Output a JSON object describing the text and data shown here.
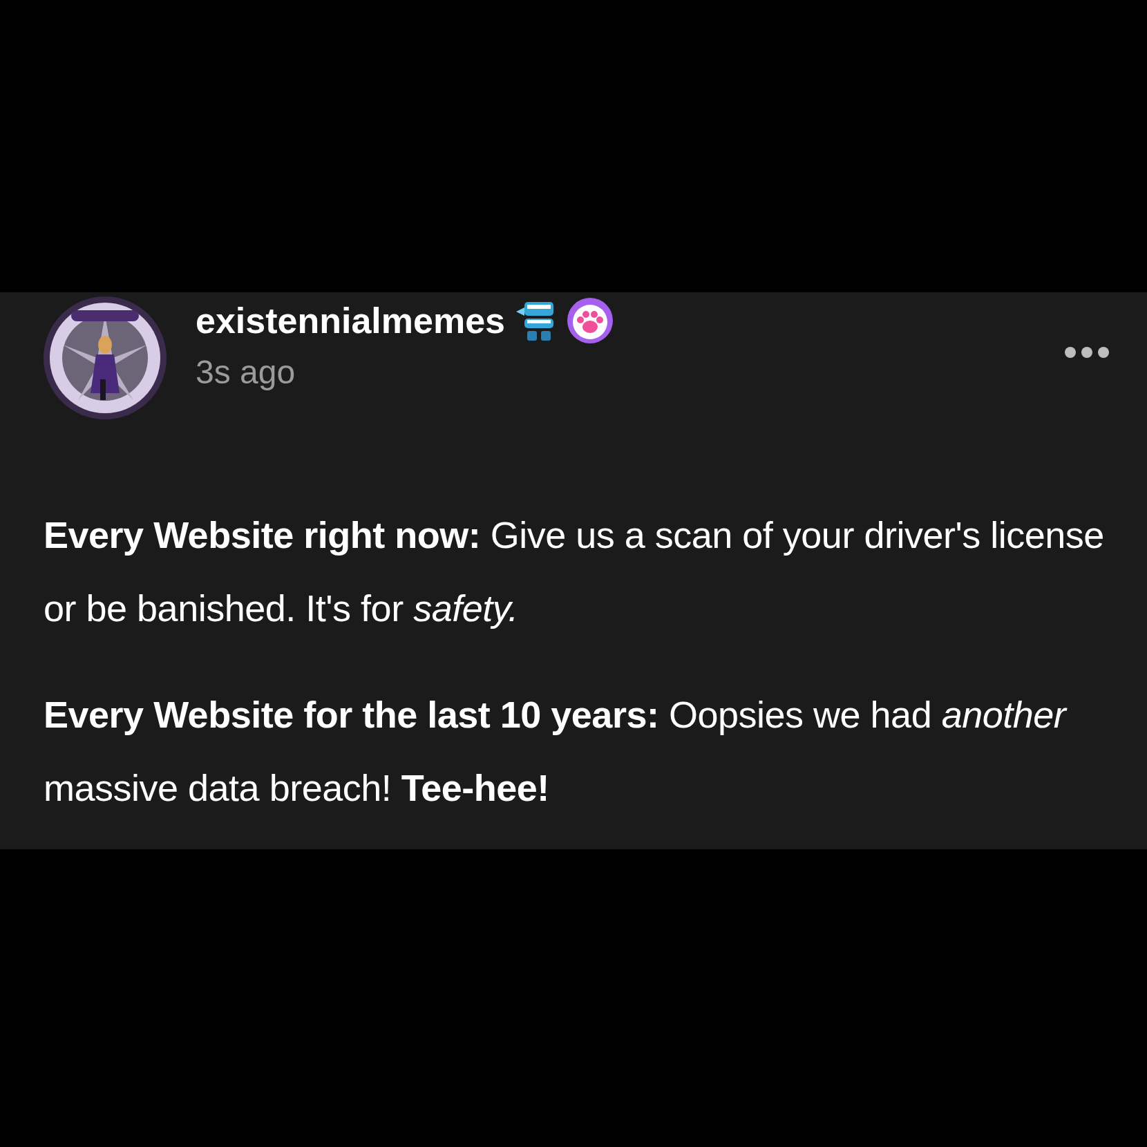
{
  "post": {
    "author": "existennialmemes",
    "time": "3s ago",
    "paragraphs": [
      "**Every Website right now:** Give us a scan of your driver's license or be banished. It's for *safety.*",
      "**Every Website for the last 10 years:** Oopsies we had *another* massive data breach! **Tee-hee!**"
    ]
  }
}
